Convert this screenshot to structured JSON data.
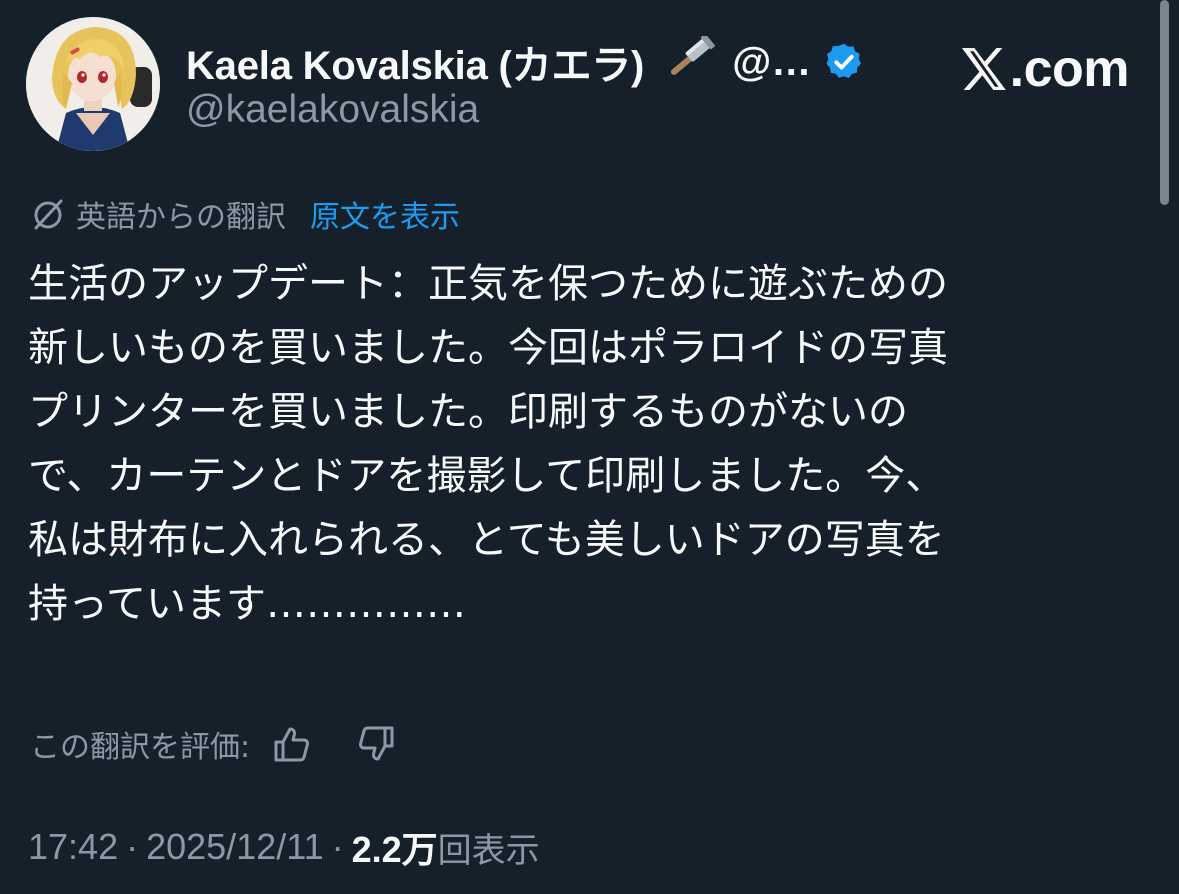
{
  "author": {
    "display_name": "Kaela Kovalskia (カエラ)",
    "handle_truncated": "@…",
    "handle": "@kaelakovalskia",
    "emoji_icon": "hammer-icon",
    "verified_icon": "verified-badge-icon"
  },
  "site": {
    "name": ".com",
    "logo_icon": "x-logo-icon"
  },
  "translation": {
    "label": "英語からの翻訳",
    "show_original": "原文を表示",
    "icon": "translate-icon"
  },
  "tweet": {
    "lines": [
      "生活のアップデート：正気を保つために遊ぶための",
      "新しいものを買いました。今回はポラロイドの写真",
      "プリンターを買いました。印刷するものがないの",
      "で、カーテンとドアを撮影して印刷しました。今、",
      "私は財布に入れられる、とても美しいドアの写真を",
      "持っています……………"
    ]
  },
  "rate": {
    "label": "この翻訳を評価:",
    "thumbs_up_icon": "thumbs-up-icon",
    "thumbs_down_icon": "thumbs-down-icon"
  },
  "meta": {
    "time": "17:42",
    "separator": "·",
    "date": "2025/12/11",
    "views_count": "2.2万",
    "views_label": "回表示"
  },
  "colors": {
    "background": "#15202b",
    "text_primary": "#f7f9f9",
    "text_secondary": "#8b98a5",
    "link": "#1d9bf0",
    "verified": "#1d9bf0"
  }
}
